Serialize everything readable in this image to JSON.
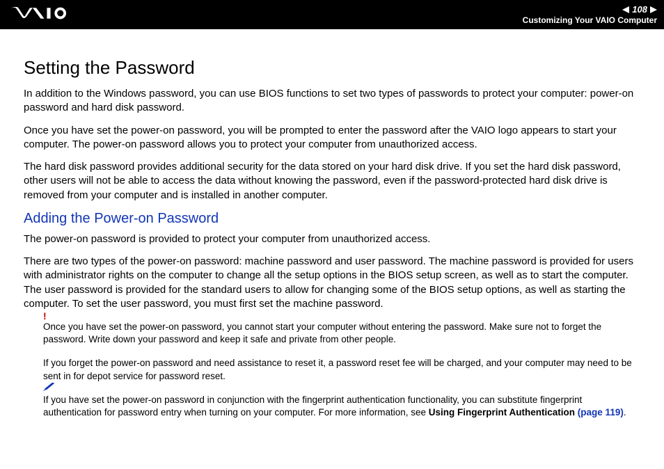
{
  "header": {
    "page_number": "108",
    "breadcrumb": "Customizing Your VAIO Computer"
  },
  "content": {
    "h1": "Setting the Password",
    "p1": "In addition to the Windows password, you can use BIOS functions to set two types of passwords to protect your computer: power-on password and hard disk password.",
    "p2": "Once you have set the power-on password, you will be prompted to enter the password after the VAIO logo appears to start your computer. The power-on password allows you to protect your computer from unauthorized access.",
    "p3": "The hard disk password provides additional security for the data stored on your hard disk drive. If you set the hard disk password, other users will not be able to access the data without knowing the password, even if the password-protected hard disk drive is removed from your computer and is installed in another computer.",
    "h2": "Adding the Power-on Password",
    "p4": "The power-on password is provided to protect your computer from unauthorized access.",
    "p5": "There are two types of the power-on password: machine password and user password. The machine password is provided for users with administrator rights on the computer to change all the setup options in the BIOS setup screen, as well as to start the computer. The user password is provided for the standard users to allow for changing some of the BIOS setup options, as well as starting the computer. To set the user password, you must first set the machine password.",
    "note1_mark": "!",
    "note1a": "Once you have set the power-on password, you cannot start your computer without entering the password. Make sure not to forget the password. Write down your password and keep it safe and private from other people.",
    "note1b": "If you forget the power-on password and need assistance to reset it, a password reset fee will be charged, and your computer may need to be sent in for depot service for password reset.",
    "note2_prefix": "If you have set the power-on password in conjunction with the fingerprint authentication functionality, you can substitute fingerprint authentication for password entry when turning on your computer. For more information, see ",
    "note2_bold": "Using Fingerprint Authentication ",
    "note2_link": "(page 119)",
    "note2_suffix": "."
  }
}
